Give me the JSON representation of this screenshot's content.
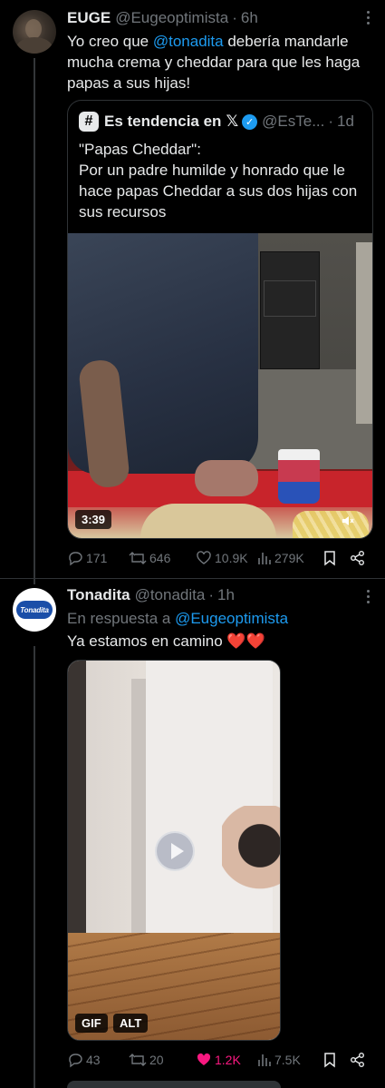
{
  "tweets": [
    {
      "name": "EUGE",
      "handle": "@Eugeoptimista",
      "time": "6h",
      "text_before": "Yo creo que ",
      "mention": "@tonadita",
      "text_after": " debería mandarle mucha crema y cheddar para que les haga papas a sus hijas!",
      "quote": {
        "name": "Es tendencia en",
        "x_glyph": "𝕏",
        "handle": "@EsTe...",
        "time": "1d",
        "text": "\"Papas Cheddar\":\nPor un padre humilde y honrado que le hace papas Cheddar a sus dos hijas con sus recursos",
        "video_duration": "3:39"
      },
      "actions": {
        "replies": "171",
        "reposts": "646",
        "likes": "10.9K",
        "views": "279K"
      }
    },
    {
      "name": "Tonadita",
      "logo_text": "Tonadita",
      "handle": "@tonadita",
      "time": "1h",
      "reply_prefix": "En respuesta a ",
      "reply_mention": "@Eugeoptimista",
      "text": "Ya estamos en camino ❤️❤️",
      "media_badges": {
        "gif": "GIF",
        "alt": "ALT"
      },
      "actions": {
        "replies": "43",
        "reposts": "20",
        "likes": "1.2K",
        "views": "7.5K"
      }
    }
  ],
  "colors": {
    "background": "#000000",
    "text": "#e7e9ea",
    "muted": "#71767b",
    "link": "#1d9bf0",
    "like": "#f91880"
  }
}
